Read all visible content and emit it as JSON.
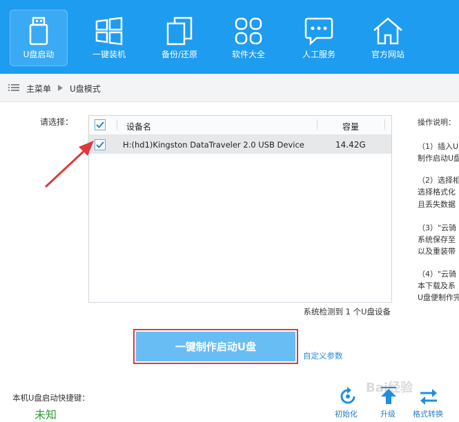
{
  "nav": {
    "items": [
      {
        "label": "U盘启动"
      },
      {
        "label": "一键装机"
      },
      {
        "label": "备份/还原"
      },
      {
        "label": "软件大全"
      },
      {
        "label": "人工服务"
      },
      {
        "label": "官方网站"
      }
    ]
  },
  "breadcrumb": {
    "home": "主菜单",
    "current": "U盘模式"
  },
  "select_label": "请选择：",
  "table": {
    "headers": {
      "device": "设备名",
      "capacity": "容量"
    },
    "rows": [
      {
        "device": "H:(hd1)Kingston DataTraveler 2.0 USB Device",
        "capacity": "14.42G",
        "checked": true
      }
    ]
  },
  "detected_text": "系统检测到 1 个U盘设备",
  "primary_button": "一键制作启动U盘",
  "custom_link": "自定义参数",
  "instructions": {
    "title": "操作说明：",
    "lines": [
      "（1）插入U",
      "制作启动U盘",
      "（2）选择相",
      "选择格式化",
      "且丢失数据",
      "（3）\"云骑",
      "系统保存至",
      "以及重装带",
      "（4）\"云骑",
      "本下载及系",
      "U盘便制作完"
    ]
  },
  "footer": {
    "hotkey_label": "本机U盘启动快捷键：",
    "hotkey_value": "未知",
    "actions": [
      {
        "label": "初始化"
      },
      {
        "label": "升级"
      },
      {
        "label": "格式转换"
      }
    ]
  },
  "watermark": "Bai经验",
  "colors": {
    "topbar": "#1e9cf0",
    "button": "#69bdf5",
    "highlight": "#e0383a",
    "green": "#2ea035"
  }
}
